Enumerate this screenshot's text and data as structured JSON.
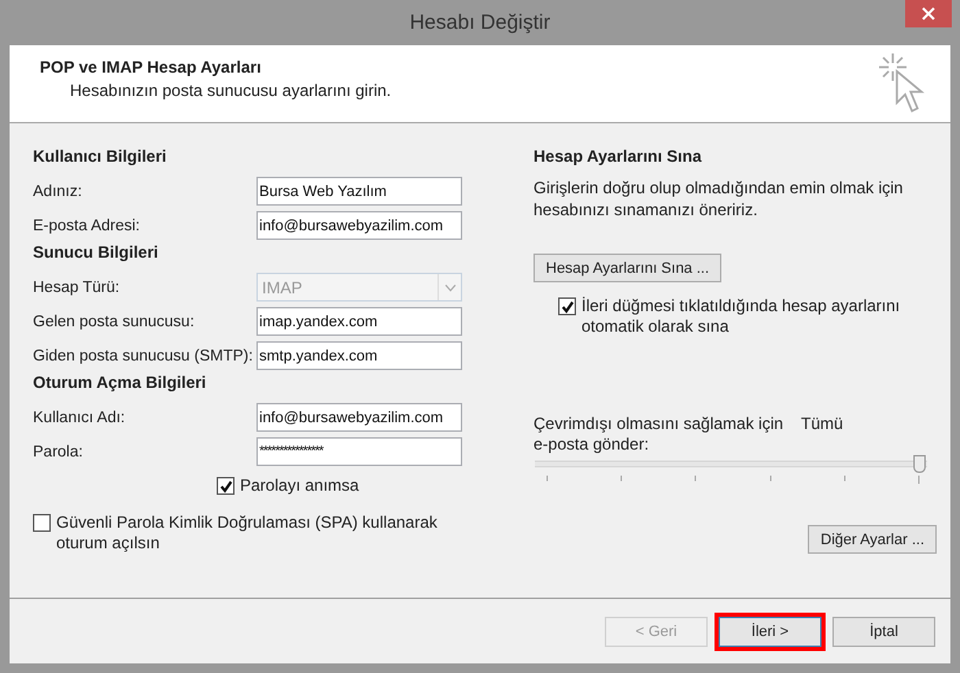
{
  "window": {
    "title": "Hesabı Değiştir"
  },
  "header": {
    "title": "POP ve IMAP Hesap Ayarları",
    "subtitle": "Hesabınızın posta sunucusu ayarlarını girin."
  },
  "left_sections": [
    {
      "title": "Kullanıcı Bilgileri",
      "fields": [
        {
          "kind": "text",
          "label": "Adınız:",
          "value": "Bursa Web Yazılım"
        },
        {
          "kind": "text",
          "label": "E-posta Adresi:",
          "value": "info@bursawebyazilim.com"
        }
      ]
    },
    {
      "title": "Sunucu Bilgileri",
      "fields": [
        {
          "kind": "dropdown",
          "label": "Hesap Türü:",
          "value": "IMAP",
          "disabled": true
        },
        {
          "kind": "text",
          "label": "Gelen posta sunucusu:",
          "value": "imap.yandex.com"
        },
        {
          "kind": "text",
          "label": "Giden posta sunucusu (SMTP):",
          "value": "smtp.yandex.com"
        }
      ]
    },
    {
      "title": "Oturum Açma Bilgileri",
      "fields": [
        {
          "kind": "text",
          "label": "Kullanıcı Adı:",
          "value": "info@bursawebyazilim.com"
        },
        {
          "kind": "password",
          "label": "Parola:",
          "value": "****************"
        }
      ]
    }
  ],
  "remember_password": {
    "label": "Parolayı anımsa",
    "checked": true
  },
  "spa": {
    "label": "Güvenli Parola Kimlik Doğrulaması (SPA) kullanarak oturum açılsın",
    "checked": false
  },
  "test_section": {
    "title": "Hesap Ayarlarını Sına",
    "description": "Girişlerin doğru olup olmadığından emin olmak için hesabınızı sınamanızı öneririz.",
    "button": "Hesap Ayarlarını Sına ...",
    "auto_test": {
      "label": "İleri düğmesi tıklatıldığında hesap ayarlarını otomatik olarak sına",
      "checked": true
    }
  },
  "offline_slider": {
    "label": "Çevrimdışı olmasını sağlamak için e-posta gönder:",
    "reading": "Tümü",
    "level": 1
  },
  "more_settings_button": "Diğer Ayarlar ...",
  "footer_buttons": [
    {
      "label": "< Geri",
      "disabled": true,
      "highlighted": false
    },
    {
      "label": "İleri >",
      "disabled": false,
      "highlighted": true
    },
    {
      "label": "İptal",
      "disabled": false,
      "highlighted": false
    }
  ]
}
